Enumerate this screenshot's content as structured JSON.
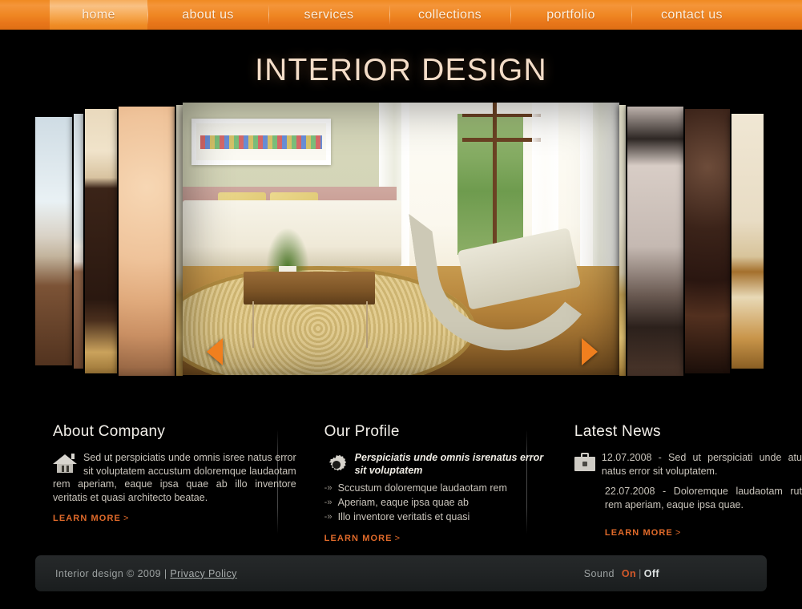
{
  "nav": {
    "items": [
      {
        "label": "home",
        "active": true
      },
      {
        "label": "about us",
        "active": false
      },
      {
        "label": "services",
        "active": false
      },
      {
        "label": "collections",
        "active": false
      },
      {
        "label": "portfolio",
        "active": false
      },
      {
        "label": "contact us",
        "active": false
      }
    ]
  },
  "hero": {
    "title": "INTERIOR DESIGN",
    "prev_arrow": "left-arrow-icon",
    "next_arrow": "right-arrow-icon"
  },
  "about": {
    "heading": "About Company",
    "icon": "home-icon",
    "text": "Sed ut perspiciatis unde omnis isree natus error sit voluptatem accustum doloremque laudaotam rem aperiam, eaque ipsa quae ab illo inventore veritatis et quasi architecto beatae.",
    "learn_more": "LEARN MORE",
    "chevron": ">"
  },
  "profile": {
    "heading": "Our Profile",
    "icon": "gear-icon",
    "lead": "Perspiciatis unde omnis isrenatus error sit voluptatem",
    "bullet": "-»",
    "items": [
      "Sccustum doloremque laudaotam rem",
      "Aperiam, eaque ipsa quae ab",
      "Illo inventore veritatis et quasi"
    ],
    "learn_more": "LEARN MORE",
    "chevron": ">"
  },
  "news": {
    "heading": "Latest News",
    "icon": "briefcase-icon",
    "items": [
      "12.07.2008 - Sed ut perspiciati unde atu natus error sit voluptatem.",
      "22.07.2008 - Doloremque laudaotam rut rem aperiam, eaque ipsa quae."
    ],
    "learn_more": "LEARN MORE",
    "chevron": ">"
  },
  "footer": {
    "copyright": "Interior design © 2009  |  ",
    "privacy": "Privacy Policy",
    "sound_label": "Sound",
    "sound_on": "On",
    "sound_sep": "|",
    "sound_off": "Off"
  },
  "colors": {
    "nav_orange": "#ef8622",
    "nav_active": "#f6a74f",
    "accent": "#e06a2a",
    "title": "#f4ddc8",
    "background": "#000000",
    "footer_bg": "#222526",
    "sound_on": "#d4592a"
  }
}
